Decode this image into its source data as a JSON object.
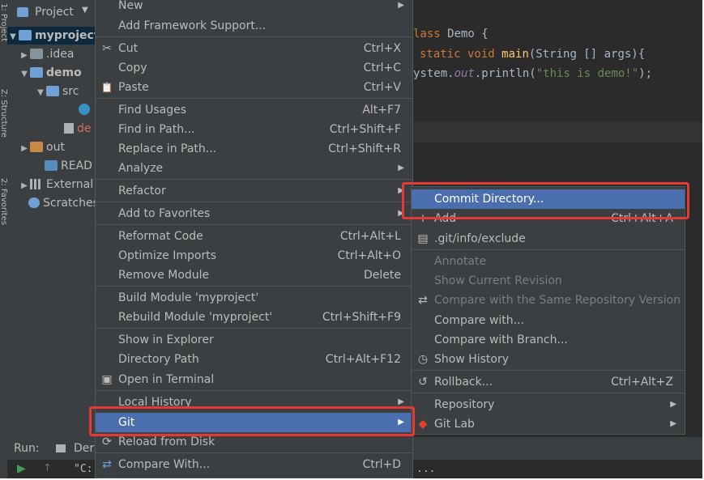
{
  "project_panel": {
    "title": "Project",
    "tree": [
      {
        "label": "myproject"
      },
      {
        "label": ".idea"
      },
      {
        "label": "demo"
      },
      {
        "label": "src"
      },
      {
        "label": ""
      },
      {
        "label": "de"
      },
      {
        "label": "out"
      },
      {
        "label": "READ"
      },
      {
        "label": "External l"
      },
      {
        "label": "Scratches"
      }
    ]
  },
  "vertical_tabs": [
    "1: Project",
    "Z: Structure",
    "2: Favorites"
  ],
  "code": {
    "line1_kw": "lass",
    "line1_rest": " Demo {",
    "line2_kw": "static void",
    "line2_fn": "main",
    "line2_rest": "(String [] args){",
    "line3_a": "ystem.",
    "line3_out": "out",
    "line3_b": ".println(",
    "line3_str": "\"this is demo!\"",
    "line3_c": ");"
  },
  "bottom": {
    "run_label": "Run:",
    "run_tab": "Der",
    "console_text": "\"C:",
    "ellipsis": "..."
  },
  "context_menu": {
    "items": [
      {
        "label": "New",
        "shortcut": "",
        "arrow": "▶",
        "icon": ""
      },
      {
        "label": "Add Framework Support...",
        "shortcut": "",
        "arrow": "",
        "icon": ""
      },
      {
        "label": "Cut",
        "shortcut": "Ctrl+X",
        "arrow": "",
        "icon": "✂"
      },
      {
        "label": "Copy",
        "shortcut": "Ctrl+C",
        "arrow": "",
        "icon": ""
      },
      {
        "label": "Paste",
        "shortcut": "Ctrl+V",
        "arrow": "",
        "icon": "📋"
      },
      {
        "label": "Find Usages",
        "shortcut": "Alt+F7",
        "arrow": "",
        "icon": ""
      },
      {
        "label": "Find in Path...",
        "shortcut": "Ctrl+Shift+F",
        "arrow": "",
        "icon": ""
      },
      {
        "label": "Replace in Path...",
        "shortcut": "Ctrl+Shift+R",
        "arrow": "",
        "icon": ""
      },
      {
        "label": "Analyze",
        "shortcut": "",
        "arrow": "▶",
        "icon": ""
      },
      {
        "label": "Refactor",
        "shortcut": "",
        "arrow": "▶",
        "icon": ""
      },
      {
        "label": "Add to Favorites",
        "shortcut": "",
        "arrow": "▶",
        "icon": ""
      },
      {
        "label": "Reformat Code",
        "shortcut": "Ctrl+Alt+L",
        "arrow": "",
        "icon": ""
      },
      {
        "label": "Optimize Imports",
        "shortcut": "Ctrl+Alt+O",
        "arrow": "",
        "icon": ""
      },
      {
        "label": "Remove Module",
        "shortcut": "Delete",
        "arrow": "",
        "icon": ""
      },
      {
        "label": "Build Module 'myproject'",
        "shortcut": "",
        "arrow": "",
        "icon": ""
      },
      {
        "label": "Rebuild Module 'myproject'",
        "shortcut": "Ctrl+Shift+F9",
        "arrow": "",
        "icon": ""
      },
      {
        "label": "Show in Explorer",
        "shortcut": "",
        "arrow": "",
        "icon": ""
      },
      {
        "label": "Directory Path",
        "shortcut": "Ctrl+Alt+F12",
        "arrow": "",
        "icon": ""
      },
      {
        "label": "Open in Terminal",
        "shortcut": "",
        "arrow": "",
        "icon": "▣"
      },
      {
        "label": "Local History",
        "shortcut": "",
        "arrow": "▶",
        "icon": ""
      },
      {
        "label": "Git",
        "shortcut": "",
        "arrow": "▶",
        "icon": ""
      },
      {
        "label": "Reload from Disk",
        "shortcut": "",
        "arrow": "",
        "icon": "⟳"
      },
      {
        "label": "Compare With...",
        "shortcut": "Ctrl+D",
        "arrow": "",
        "icon": "⇄"
      }
    ]
  },
  "git_submenu": {
    "items": [
      {
        "label": "Commit Directory...",
        "shortcut": "",
        "arrow": "",
        "icon": ""
      },
      {
        "label": "Add",
        "shortcut": "Ctrl+Alt+A",
        "arrow": "",
        "icon": "+"
      },
      {
        "label": ".git/info/exclude",
        "shortcut": "",
        "arrow": "",
        "icon": "▤"
      },
      {
        "label": "Annotate",
        "shortcut": "",
        "arrow": "",
        "icon": ""
      },
      {
        "label": "Show Current Revision",
        "shortcut": "",
        "arrow": "",
        "icon": ""
      },
      {
        "label": "Compare with the Same Repository Version",
        "shortcut": "",
        "arrow": "",
        "icon": "⇄"
      },
      {
        "label": "Compare with...",
        "shortcut": "",
        "arrow": "",
        "icon": ""
      },
      {
        "label": "Compare with Branch...",
        "shortcut": "",
        "arrow": "",
        "icon": ""
      },
      {
        "label": "Show History",
        "shortcut": "",
        "arrow": "",
        "icon": "◷"
      },
      {
        "label": "Rollback...",
        "shortcut": "Ctrl+Alt+Z",
        "arrow": "",
        "icon": "↺"
      },
      {
        "label": "Repository",
        "shortcut": "",
        "arrow": "▶",
        "icon": ""
      },
      {
        "label": "Git Lab",
        "shortcut": "",
        "arrow": "▶",
        "icon": "◆"
      }
    ]
  },
  "colors": {
    "menu_bg": "#3c3f41",
    "selection": "#4b6eaf",
    "highlight_box": "#e53935",
    "gitlab_orange": "#e24329"
  }
}
